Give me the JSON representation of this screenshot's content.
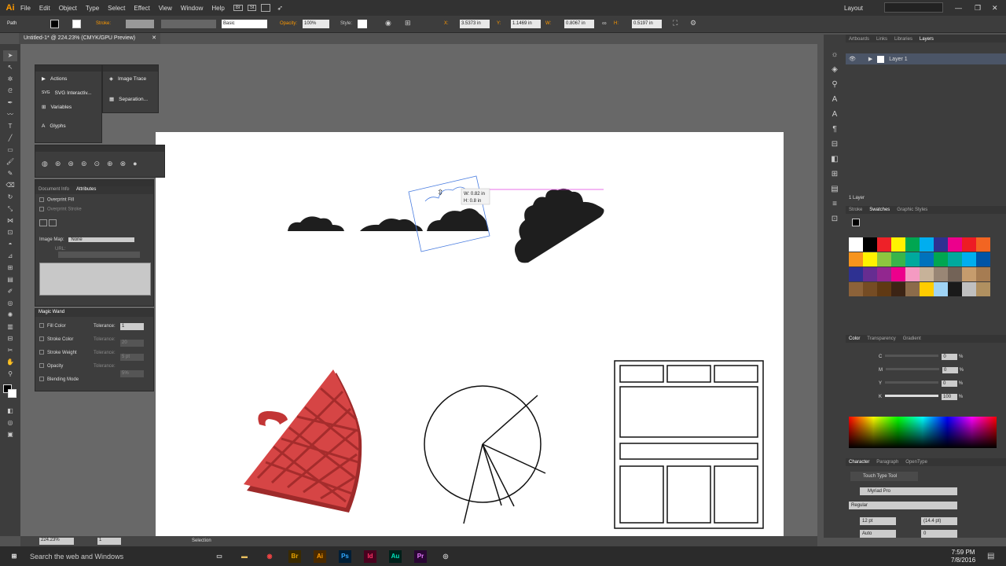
{
  "app": {
    "logo": "Ai",
    "doc_tab": "Untitled-1* @ 224.23% (CMYK/GPU Preview)"
  },
  "menu": [
    "File",
    "Edit",
    "Object",
    "Type",
    "Select",
    "Effect",
    "View",
    "Window",
    "Help"
  ],
  "menu_badges": [
    "Br",
    "St"
  ],
  "workspace": "Layout",
  "control": {
    "object": "Path",
    "stroke_label": "Stroke:",
    "brush": "Basic",
    "opacity_label": "Opacity:",
    "opacity": "100%",
    "style_label": "Style:",
    "x_label": "X:",
    "x": "3.5373 in",
    "y_label": "Y:",
    "y": "1.1469 in",
    "w_label": "W:",
    "w": "0.8067 in",
    "h_label": "H:",
    "h": "0.5197 in"
  },
  "float_panel": {
    "items": [
      "Actions",
      "SVG Interactiv...",
      "Variables",
      "Glyphs"
    ],
    "items2": [
      "Image Trace",
      "Separation..."
    ]
  },
  "attributes": {
    "tabs": [
      "Document Info",
      "Attributes"
    ],
    "overprint_fill": "Overprint Fill",
    "overprint_stroke": "Overprint Stroke",
    "image_map_label": "Image Map:",
    "image_map": "None",
    "url_label": "URL:"
  },
  "magic_wand": {
    "title": "Magic Wand",
    "fill": "Fill Color",
    "stroke": "Stroke Color",
    "weight": "Stroke Weight",
    "opacity": "Opacity",
    "blending": "Blending Mode",
    "tol_label": "Tolerance:",
    "tol_fill": "1",
    "tol_stroke": "20",
    "tol_weight": "5 pt",
    "tol_opacity": "5%"
  },
  "tooltip": {
    "w": "W: 0.82 in",
    "h": "H: 0.8 in"
  },
  "layers": {
    "tabs": [
      "Artboards",
      "Links",
      "Libraries",
      "Layers"
    ],
    "layer": "Layer 1",
    "count": "1 Layer"
  },
  "swatches": {
    "tabs": [
      "Stroke",
      "Swatches",
      "Graphic Styles"
    ],
    "colors": [
      "#ffffff",
      "#000000",
      "#ee2128",
      "#fff200",
      "#00a651",
      "#00aeef",
      "#2e3192",
      "#ec008c",
      "#ed1c24",
      "#f26522",
      "#f7941d",
      "#fff200",
      "#8dc63f",
      "#39b54a",
      "#00a99d",
      "#0072bc",
      "#00a651",
      "#00a99d",
      "#00aeef",
      "#0054a6",
      "#2e3192",
      "#662d91",
      "#92278f",
      "#ec008c",
      "#f49ac2",
      "#c7b299",
      "#998675",
      "#736357",
      "#c69c6d",
      "#a67c52",
      "#8c6239",
      "#754c24",
      "#603913",
      "#3c2415",
      "#8b6b4a",
      "#ffcc00",
      "#9fd4f5",
      "#1a1a1a",
      "#c0c0c0",
      "#b09060"
    ]
  },
  "color": {
    "tabs": [
      "Color",
      "Transparency",
      "Gradient"
    ],
    "c": "0",
    "m": "0",
    "y": "0",
    "k": "100",
    "labels": [
      "C",
      "M",
      "Y",
      "K"
    ],
    "pct": "%"
  },
  "character": {
    "tabs": [
      "Character",
      "Paragraph",
      "OpenType"
    ],
    "tool": "Touch Type Tool",
    "font": "Myriad Pro",
    "style": "Regular",
    "size": "12 pt",
    "leading": "(14.4 pt)",
    "tracking": "Auto",
    "kerning": "0"
  },
  "status": {
    "zoom": "224.23%",
    "page": "1",
    "tool": "Selection"
  },
  "taskbar": {
    "search": "Search the web and Windows",
    "time": "7:59 PM",
    "date": "7/8/2016",
    "apps": [
      {
        "t": "Br",
        "c": "#e8a300"
      },
      {
        "t": "Ai",
        "c": "#ff9a00"
      },
      {
        "t": "Ps",
        "c": "#31a8ff"
      },
      {
        "t": "Id",
        "c": "#ff3366"
      },
      {
        "t": "Au",
        "c": "#00e4bb"
      },
      {
        "t": "Pr",
        "c": "#e77bff"
      }
    ]
  }
}
